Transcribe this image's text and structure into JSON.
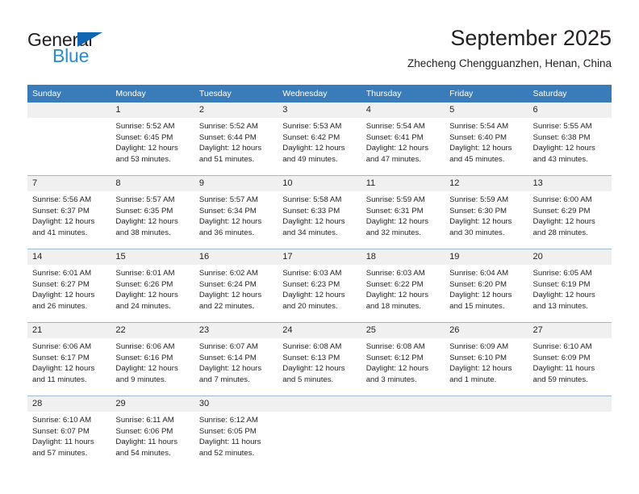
{
  "brand": {
    "word_one": "General",
    "word_two": "Blue",
    "triangle_color": "#1066b0",
    "blue_text_color": "#2a8ad4",
    "dark_text_color": "#231f20"
  },
  "header": {
    "title": "September 2025",
    "subtitle": "Zhecheng Chengguanzhen, Henan, China"
  },
  "theme": {
    "header_row_bg": "#3a7cba",
    "header_row_text": "#ffffff",
    "daynum_bg": "#f0f0f0",
    "row_divider": "#9fb9d2"
  },
  "weekdays": [
    "Sunday",
    "Monday",
    "Tuesday",
    "Wednesday",
    "Thursday",
    "Friday",
    "Saturday"
  ],
  "weeks": [
    [
      {
        "day": "",
        "lines": []
      },
      {
        "day": "1",
        "lines": [
          "Sunrise: 5:52 AM",
          "Sunset: 6:45 PM",
          "Daylight: 12 hours",
          "and 53 minutes."
        ]
      },
      {
        "day": "2",
        "lines": [
          "Sunrise: 5:52 AM",
          "Sunset: 6:44 PM",
          "Daylight: 12 hours",
          "and 51 minutes."
        ]
      },
      {
        "day": "3",
        "lines": [
          "Sunrise: 5:53 AM",
          "Sunset: 6:42 PM",
          "Daylight: 12 hours",
          "and 49 minutes."
        ]
      },
      {
        "day": "4",
        "lines": [
          "Sunrise: 5:54 AM",
          "Sunset: 6:41 PM",
          "Daylight: 12 hours",
          "and 47 minutes."
        ]
      },
      {
        "day": "5",
        "lines": [
          "Sunrise: 5:54 AM",
          "Sunset: 6:40 PM",
          "Daylight: 12 hours",
          "and 45 minutes."
        ]
      },
      {
        "day": "6",
        "lines": [
          "Sunrise: 5:55 AM",
          "Sunset: 6:38 PM",
          "Daylight: 12 hours",
          "and 43 minutes."
        ]
      }
    ],
    [
      {
        "day": "7",
        "lines": [
          "Sunrise: 5:56 AM",
          "Sunset: 6:37 PM",
          "Daylight: 12 hours",
          "and 41 minutes."
        ]
      },
      {
        "day": "8",
        "lines": [
          "Sunrise: 5:57 AM",
          "Sunset: 6:35 PM",
          "Daylight: 12 hours",
          "and 38 minutes."
        ]
      },
      {
        "day": "9",
        "lines": [
          "Sunrise: 5:57 AM",
          "Sunset: 6:34 PM",
          "Daylight: 12 hours",
          "and 36 minutes."
        ]
      },
      {
        "day": "10",
        "lines": [
          "Sunrise: 5:58 AM",
          "Sunset: 6:33 PM",
          "Daylight: 12 hours",
          "and 34 minutes."
        ]
      },
      {
        "day": "11",
        "lines": [
          "Sunrise: 5:59 AM",
          "Sunset: 6:31 PM",
          "Daylight: 12 hours",
          "and 32 minutes."
        ]
      },
      {
        "day": "12",
        "lines": [
          "Sunrise: 5:59 AM",
          "Sunset: 6:30 PM",
          "Daylight: 12 hours",
          "and 30 minutes."
        ]
      },
      {
        "day": "13",
        "lines": [
          "Sunrise: 6:00 AM",
          "Sunset: 6:29 PM",
          "Daylight: 12 hours",
          "and 28 minutes."
        ]
      }
    ],
    [
      {
        "day": "14",
        "lines": [
          "Sunrise: 6:01 AM",
          "Sunset: 6:27 PM",
          "Daylight: 12 hours",
          "and 26 minutes."
        ]
      },
      {
        "day": "15",
        "lines": [
          "Sunrise: 6:01 AM",
          "Sunset: 6:26 PM",
          "Daylight: 12 hours",
          "and 24 minutes."
        ]
      },
      {
        "day": "16",
        "lines": [
          "Sunrise: 6:02 AM",
          "Sunset: 6:24 PM",
          "Daylight: 12 hours",
          "and 22 minutes."
        ]
      },
      {
        "day": "17",
        "lines": [
          "Sunrise: 6:03 AM",
          "Sunset: 6:23 PM",
          "Daylight: 12 hours",
          "and 20 minutes."
        ]
      },
      {
        "day": "18",
        "lines": [
          "Sunrise: 6:03 AM",
          "Sunset: 6:22 PM",
          "Daylight: 12 hours",
          "and 18 minutes."
        ]
      },
      {
        "day": "19",
        "lines": [
          "Sunrise: 6:04 AM",
          "Sunset: 6:20 PM",
          "Daylight: 12 hours",
          "and 15 minutes."
        ]
      },
      {
        "day": "20",
        "lines": [
          "Sunrise: 6:05 AM",
          "Sunset: 6:19 PM",
          "Daylight: 12 hours",
          "and 13 minutes."
        ]
      }
    ],
    [
      {
        "day": "21",
        "lines": [
          "Sunrise: 6:06 AM",
          "Sunset: 6:17 PM",
          "Daylight: 12 hours",
          "and 11 minutes."
        ]
      },
      {
        "day": "22",
        "lines": [
          "Sunrise: 6:06 AM",
          "Sunset: 6:16 PM",
          "Daylight: 12 hours",
          "and 9 minutes."
        ]
      },
      {
        "day": "23",
        "lines": [
          "Sunrise: 6:07 AM",
          "Sunset: 6:14 PM",
          "Daylight: 12 hours",
          "and 7 minutes."
        ]
      },
      {
        "day": "24",
        "lines": [
          "Sunrise: 6:08 AM",
          "Sunset: 6:13 PM",
          "Daylight: 12 hours",
          "and 5 minutes."
        ]
      },
      {
        "day": "25",
        "lines": [
          "Sunrise: 6:08 AM",
          "Sunset: 6:12 PM",
          "Daylight: 12 hours",
          "and 3 minutes."
        ]
      },
      {
        "day": "26",
        "lines": [
          "Sunrise: 6:09 AM",
          "Sunset: 6:10 PM",
          "Daylight: 12 hours",
          "and 1 minute."
        ]
      },
      {
        "day": "27",
        "lines": [
          "Sunrise: 6:10 AM",
          "Sunset: 6:09 PM",
          "Daylight: 11 hours",
          "and 59 minutes."
        ]
      }
    ],
    [
      {
        "day": "28",
        "lines": [
          "Sunrise: 6:10 AM",
          "Sunset: 6:07 PM",
          "Daylight: 11 hours",
          "and 57 minutes."
        ]
      },
      {
        "day": "29",
        "lines": [
          "Sunrise: 6:11 AM",
          "Sunset: 6:06 PM",
          "Daylight: 11 hours",
          "and 54 minutes."
        ]
      },
      {
        "day": "30",
        "lines": [
          "Sunrise: 6:12 AM",
          "Sunset: 6:05 PM",
          "Daylight: 11 hours",
          "and 52 minutes."
        ]
      },
      {
        "day": "",
        "lines": []
      },
      {
        "day": "",
        "lines": []
      },
      {
        "day": "",
        "lines": []
      },
      {
        "day": "",
        "lines": []
      }
    ]
  ]
}
